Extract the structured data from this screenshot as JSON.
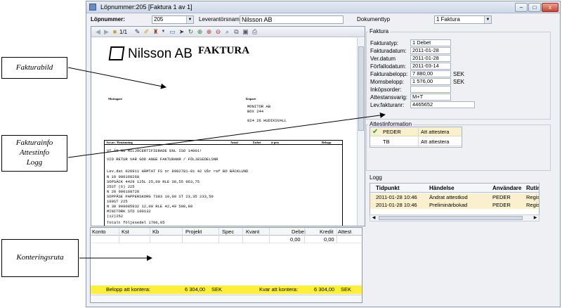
{
  "annotations": {
    "fakturabild": "Fakturabild",
    "fakturainfo": [
      "Fakturainfo",
      "Attestinfo",
      "Logg"
    ],
    "konteringsruta": "Konteringsruta"
  },
  "window": {
    "title": "Löpnummer:205 [Faktura 1 av 1]",
    "buttons": {
      "min": "–",
      "max": "□",
      "close": "x"
    }
  },
  "header": {
    "lopnummer_label": "Löpnummer:",
    "lopnummer_value": "205",
    "leverantor_label": "Leverantörsnamn:",
    "leverantor_value": "Nilsson AB",
    "dokumenttyp_label": "Dokumenttyp",
    "dokumenttyp_value": "1 Faktura"
  },
  "image_viewer": {
    "page_indicator": "1/1",
    "icons": [
      "arrow-left-icon",
      "arrow-right-icon",
      "folder-icon",
      "pen-icon",
      "highlighter-icon",
      "stamp-icon",
      "comment-icon",
      "pointer-icon",
      "rotate-icon",
      "zoom-fit-icon",
      "zoom-in-icon",
      "zoom-out-icon",
      "zoom-icon",
      "fit-page-icon",
      "print-icon"
    ]
  },
  "invoice_doc": {
    "brand": "Nilsson AB",
    "doc_title": "FAKTURA",
    "mottagare": "Mottagare",
    "kopare": "Köpare",
    "buyer_lines": [
      "MONITOR AB",
      "BOX 244",
      "824 26 HUDIKSVALL"
    ],
    "table_header": [
      "Art.nr / Benämning",
      "Antal",
      "Enhet",
      "á-pris",
      "Belopp"
    ],
    "lines": [
      "VI ÄR NU MILJÖCERTIFIERADE ENL ISO 14001!",
      "VID RETUR VAR GOD ANGE FAKTURANR / FÖLJESEDELSNR",
      "Lev.dat 020911 HÄMTAT    FS nr 8092781-01  42    Vår ref BO BÄCKLUND",
      "N   10 000168268",
      "       SOPSÄCK 4429 125L                  25,00 RLE        38,55          963,75",
      "       25ST              (6) 225",
      "N   20 000168728",
      "       SOPPÅSE PAPPERSKORG 7383           10,00 ST         23,35          233,50",
      "       100ST                  225",
      "N   30 900085932                          12,00 RLE        42,40          508,80",
      "       MINITORK STD 100132",
      "                        (12)252",
      "                                                     Totalt följesedel    1706,05"
    ]
  },
  "faktura": {
    "title": "Faktura",
    "rows": [
      {
        "label": "Fakturatyp:",
        "value": "1 Debet"
      },
      {
        "label": "Fakturadatum:",
        "value": "2011-01-28"
      },
      {
        "label": "Ver.datum",
        "value": "2011-01-28"
      },
      {
        "label": "Förfallodatum:",
        "value": "2011-03-14"
      },
      {
        "label": "Fakturabelopp:",
        "value": "7 880,00",
        "currency": "SEK"
      },
      {
        "label": "Momsbelopp:",
        "value": "1 576,00",
        "currency": "SEK"
      },
      {
        "label": "Inköpsorder:",
        "value": ""
      },
      {
        "label": "Attestansvarig:",
        "value": "M+T"
      },
      {
        "label": "Lev.fakturanr:",
        "value": "4465652"
      }
    ]
  },
  "attest": {
    "title": "Attestinformation",
    "rows": [
      {
        "name": "PEDER",
        "status": "Att attestera",
        "checked": true
      },
      {
        "name": "TB",
        "status": "Att attestera",
        "checked": false
      }
    ]
  },
  "log": {
    "title": "Logg",
    "columns": [
      "Tidpunkt",
      "Händelse",
      "Användare",
      "Rutin"
    ],
    "rows": [
      [
        "2011-01-28 10:46",
        "Ändrat attestkod",
        "PEDER",
        "Registrera le"
      ],
      [
        "2011-01-28 10:46",
        "Preliminärbokad",
        "PEDER",
        "Registrera le"
      ]
    ]
  },
  "kontering": {
    "columns": [
      "Konto",
      "Kst",
      "Kb",
      "Projekt",
      "Spec",
      "Kvant",
      "Debet",
      "Kredit",
      "Attest"
    ],
    "row": {
      "debet": "0,00",
      "kredit": "0,00"
    },
    "belopp_label": "Belopp att kontera:",
    "belopp_value": "6 304,00",
    "belopp_currency": "SEK",
    "kvar_label": "Kvar att kontera:",
    "kvar_value": "6 304,00",
    "kvar_currency": "SEK"
  }
}
